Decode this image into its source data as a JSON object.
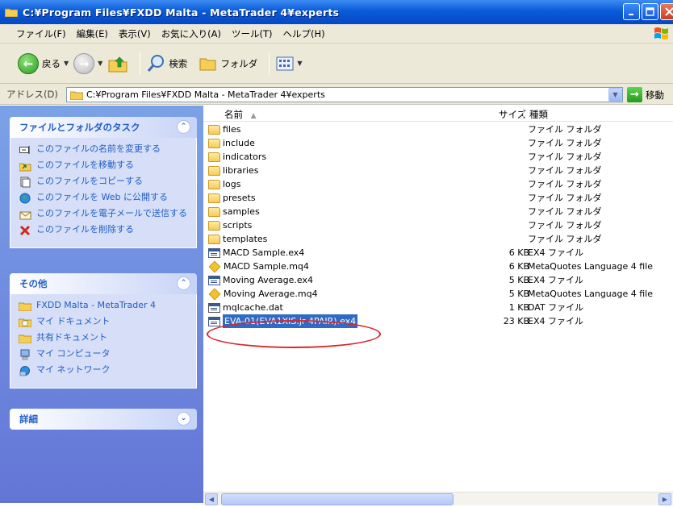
{
  "window": {
    "title": "C:¥Program Files¥FXDD Malta - MetaTrader 4¥experts"
  },
  "menu": [
    "ファイル(F)",
    "編集(E)",
    "表示(V)",
    "お気に入り(A)",
    "ツール(T)",
    "ヘルプ(H)"
  ],
  "toolbar": {
    "back_label": "戻る",
    "search_label": "検索",
    "folders_label": "フォルダ"
  },
  "address": {
    "label": "アドレス(D)",
    "value": "C:¥Program Files¥FXDD Malta - MetaTrader 4¥experts",
    "go_label": "移動"
  },
  "tasks_panel": {
    "title": "ファイルとフォルダのタスク",
    "items": [
      "このファイルの名前を変更する",
      "このファイルを移動する",
      "このファイルをコピーする",
      "このファイルを Web に公開する",
      "このファイルを電子メールで送信する",
      "このファイルを削除する"
    ]
  },
  "other_panel": {
    "title": "その他",
    "items": [
      "FXDD Malta - MetaTrader 4",
      "マイ ドキュメント",
      "共有ドキュメント",
      "マイ コンピュータ",
      "マイ ネットワーク"
    ]
  },
  "details_panel": {
    "title": "詳細"
  },
  "columns": {
    "name": "名前",
    "size": "サイズ",
    "type": "種類"
  },
  "files": [
    {
      "name": "files",
      "size": "",
      "type": "ファイル フォルダ",
      "icon": "folder"
    },
    {
      "name": "include",
      "size": "",
      "type": "ファイル フォルダ",
      "icon": "folder"
    },
    {
      "name": "indicators",
      "size": "",
      "type": "ファイル フォルダ",
      "icon": "folder"
    },
    {
      "name": "libraries",
      "size": "",
      "type": "ファイル フォルダ",
      "icon": "folder"
    },
    {
      "name": "logs",
      "size": "",
      "type": "ファイル フォルダ",
      "icon": "folder"
    },
    {
      "name": "presets",
      "size": "",
      "type": "ファイル フォルダ",
      "icon": "folder"
    },
    {
      "name": "samples",
      "size": "",
      "type": "ファイル フォルダ",
      "icon": "folder"
    },
    {
      "name": "scripts",
      "size": "",
      "type": "ファイル フォルダ",
      "icon": "folder"
    },
    {
      "name": "templates",
      "size": "",
      "type": "ファイル フォルダ",
      "icon": "folder"
    },
    {
      "name": "MACD Sample.ex4",
      "size": "6 KB",
      "type": "EX4 ファイル",
      "icon": "ex4"
    },
    {
      "name": "MACD Sample.mq4",
      "size": "6 KB",
      "type": "MetaQuotes Language 4 file",
      "icon": "mq4"
    },
    {
      "name": "Moving Average.ex4",
      "size": "5 KB",
      "type": "EX4 ファイル",
      "icon": "ex4"
    },
    {
      "name": "Moving Average.mq4",
      "size": "5 KB",
      "type": "MetaQuotes Language 4 file",
      "icon": "mq4"
    },
    {
      "name": "mqlcache.dat",
      "size": "1 KB",
      "type": "DAT ファイル",
      "icon": "dat"
    },
    {
      "name": "EVA-01(EVA1XIS.jr 4PAIR).ex4",
      "size": "23 KB",
      "type": "EX4 ファイル",
      "icon": "ex4",
      "selected": true
    }
  ],
  "colors": {
    "title_bar": "#0a5bd9",
    "task_pane": "#6f8ee0",
    "link_blue": "#215dc6",
    "selection": "#316ac5",
    "annotation_ring": "#d9262c"
  }
}
